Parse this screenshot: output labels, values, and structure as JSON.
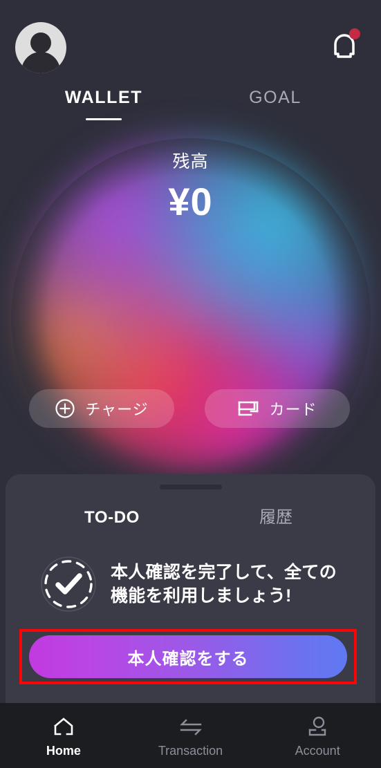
{
  "header": {
    "avatar_name": "user-avatar",
    "notification_icon": "bell-icon",
    "has_notification": true,
    "notification_dot_color": "#c42a43"
  },
  "main_tabs": [
    {
      "label": "WALLET",
      "active": true
    },
    {
      "label": "GOAL",
      "active": false
    }
  ],
  "balance": {
    "label": "残高",
    "amount": "¥0"
  },
  "actions": [
    {
      "label": "チャージ",
      "icon": "plus-circle-icon"
    },
    {
      "label": "カード",
      "icon": "card-icon"
    }
  ],
  "sheet": {
    "tabs": [
      {
        "label": "TO-DO",
        "active": true
      },
      {
        "label": "履歴",
        "active": false
      }
    ],
    "todo": {
      "icon": "check-circle-dashed-icon",
      "message_line1": "本人確認を完了して、全ての",
      "message_line2": "機能を利用しましょう!",
      "cta_label": "本人確認をする",
      "cta_gradient_start": "#c13ae0",
      "cta_gradient_end": "#5f79f2"
    }
  },
  "annotation": {
    "highlight_color": "#fb0606",
    "target": "本人確認をする"
  },
  "bottom_nav": [
    {
      "label": "Home",
      "icon": "home-icon",
      "active": true
    },
    {
      "label": "Transaction",
      "icon": "swap-arrows-icon",
      "active": false
    },
    {
      "label": "Account",
      "icon": "person-icon",
      "active": false
    }
  ],
  "theme": {
    "background": "#2e2f3b",
    "sheet_background": "#3a3b47",
    "nav_background": "#1c1d21",
    "orb_colors": [
      "#3cb9e2",
      "#a852dc",
      "#e8803c",
      "#ec345c",
      "#d628be",
      "#786ee6"
    ]
  }
}
